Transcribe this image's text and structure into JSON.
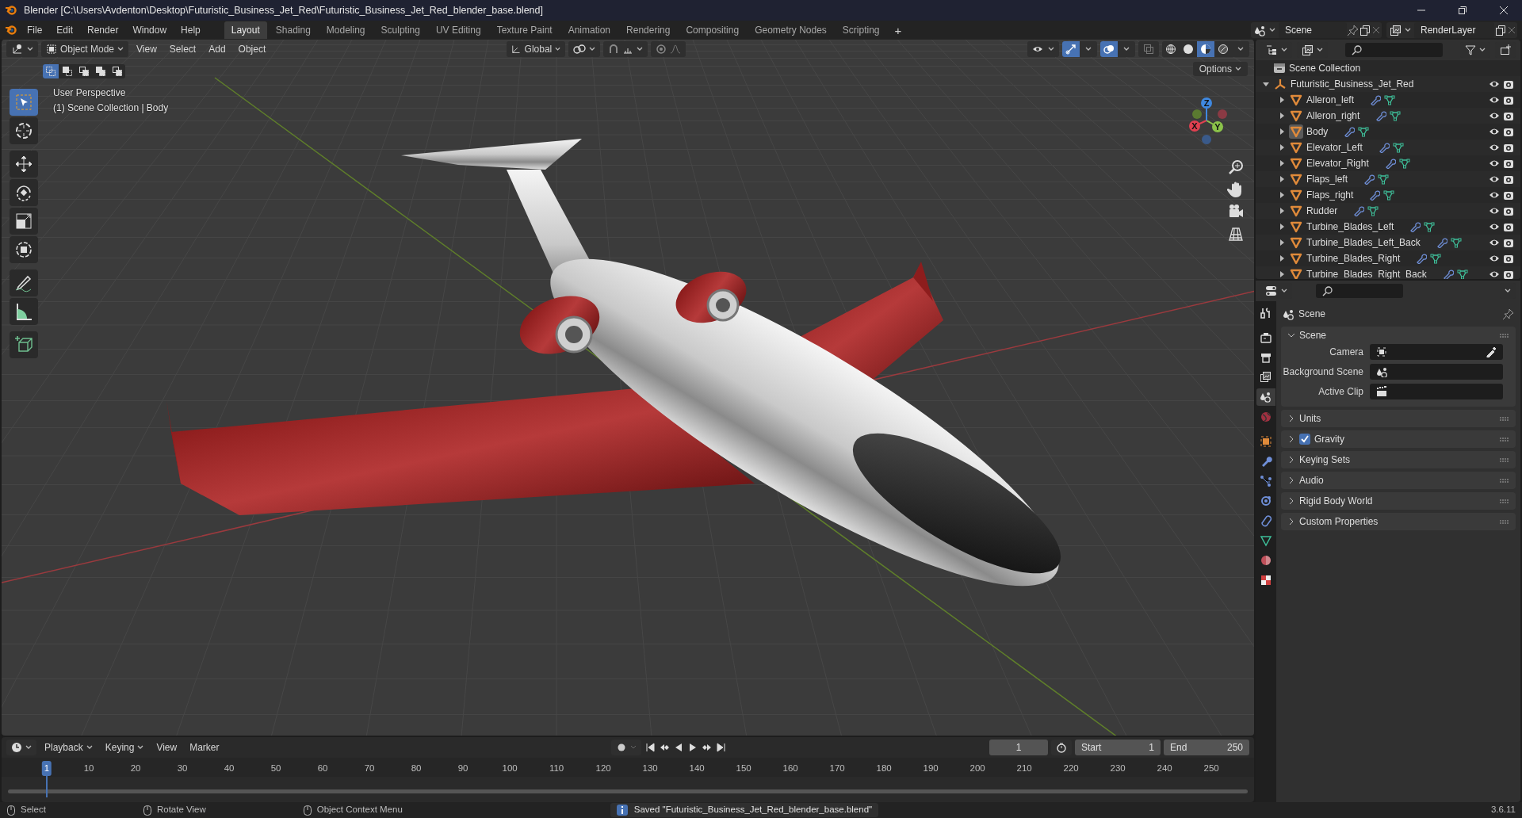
{
  "window": {
    "title": "Blender [C:\\Users\\Avdenton\\Desktop\\Futuristic_Business_Jet_Red\\Futuristic_Business_Jet_Red_blender_base.blend]"
  },
  "menu": [
    "File",
    "Edit",
    "Render",
    "Window",
    "Help"
  ],
  "workspaces": [
    {
      "label": "Layout",
      "selected": true
    },
    {
      "label": "Shading",
      "selected": false
    },
    {
      "label": "Modeling",
      "selected": false
    },
    {
      "label": "Sculpting",
      "selected": false
    },
    {
      "label": "UV Editing",
      "selected": false
    },
    {
      "label": "Texture Paint",
      "selected": false
    },
    {
      "label": "Animation",
      "selected": false
    },
    {
      "label": "Rendering",
      "selected": false
    },
    {
      "label": "Compositing",
      "selected": false
    },
    {
      "label": "Geometry Nodes",
      "selected": false
    },
    {
      "label": "Scripting",
      "selected": false
    }
  ],
  "add_workspace": "+",
  "scene": {
    "name": "Scene"
  },
  "view_layer": {
    "name": "RenderLayer"
  },
  "viewport": {
    "mode": "Object Mode",
    "menus": [
      "View",
      "Select",
      "Add",
      "Object"
    ],
    "orientation": "Global",
    "options": "Options",
    "info": [
      "User Perspective",
      "(1) Scene Collection | Body"
    ],
    "select_modes": [
      {
        "selected": true
      },
      {
        "selected": false
      },
      {
        "selected": false
      },
      {
        "selected": false
      },
      {
        "selected": false
      }
    ],
    "tools": [
      {
        "kind": "select",
        "selected": true
      },
      {
        "kind": "cursor",
        "selected": false
      },
      {
        "kind": "move",
        "selected": false
      },
      {
        "kind": "rotate",
        "selected": false
      },
      {
        "kind": "scale",
        "selected": false
      },
      {
        "kind": "transform",
        "selected": false
      },
      {
        "kind": "annotate",
        "selected": false
      },
      {
        "kind": "measure",
        "selected": false
      },
      {
        "kind": "add_cube",
        "selected": false
      }
    ],
    "shading": [
      {
        "kind": "wireframe",
        "selected": false
      },
      {
        "kind": "solid",
        "selected": false
      },
      {
        "kind": "material",
        "selected": true
      },
      {
        "kind": "rendered",
        "selected": false
      }
    ],
    "gizmo": {
      "x": "X",
      "y": "Y",
      "z": "Z"
    }
  },
  "outliner": {
    "root": "Scene Collection",
    "children": [
      {
        "name": "Futuristic_Business_Jet_Red",
        "kind": "collection",
        "expanded": true,
        "selected": false,
        "children": [
          {
            "name": "Alleron_left",
            "kind": "object",
            "expanded": false,
            "selected": false
          },
          {
            "name": "Alleron_right",
            "kind": "object",
            "expanded": false,
            "selected": false
          },
          {
            "name": "Body",
            "kind": "object",
            "expanded": false,
            "selected": true
          },
          {
            "name": "Elevator_Left",
            "kind": "object",
            "expanded": false,
            "selected": false
          },
          {
            "name": "Elevator_Right",
            "kind": "object",
            "expanded": false,
            "selected": false
          },
          {
            "name": "Flaps_left",
            "kind": "object",
            "expanded": false,
            "selected": false
          },
          {
            "name": "Flaps_right",
            "kind": "object",
            "expanded": false,
            "selected": false
          },
          {
            "name": "Rudder",
            "kind": "object",
            "expanded": false,
            "selected": false
          },
          {
            "name": "Turbine_Blades_Left",
            "kind": "object",
            "expanded": false,
            "selected": false
          },
          {
            "name": "Turbine_Blades_Left_Back",
            "kind": "object",
            "expanded": false,
            "selected": false
          },
          {
            "name": "Turbine_Blades_Right",
            "kind": "object",
            "expanded": false,
            "selected": false
          },
          {
            "name": "Turbine_Blades_Right_Back",
            "kind": "object",
            "expanded": false,
            "selected": false
          }
        ]
      }
    ]
  },
  "properties": {
    "tabs": [
      {
        "kind": "tool",
        "selected": false
      },
      {
        "kind": "render",
        "selected": false
      },
      {
        "kind": "output",
        "selected": false
      },
      {
        "kind": "view_layer",
        "selected": false
      },
      {
        "kind": "scene",
        "selected": true
      },
      {
        "kind": "world",
        "selected": false
      },
      {
        "kind": "object",
        "selected": false
      },
      {
        "kind": "modifiers",
        "selected": false
      },
      {
        "kind": "particles",
        "selected": false
      },
      {
        "kind": "physics",
        "selected": false
      },
      {
        "kind": "constraints",
        "selected": false
      },
      {
        "kind": "data",
        "selected": false
      },
      {
        "kind": "material",
        "selected": false
      },
      {
        "kind": "texture",
        "selected": false
      }
    ],
    "title": "Scene",
    "panels": [
      {
        "title": "Scene",
        "kind": "section",
        "expanded": true,
        "fields": [
          {
            "label": "Camera",
            "kind": "camera"
          },
          {
            "label": "Background Scene",
            "kind": "scene"
          },
          {
            "label": "Active Clip",
            "kind": "clip"
          }
        ]
      },
      {
        "title": "Units",
        "kind": "section",
        "expanded": false
      },
      {
        "title": "Gravity",
        "kind": "toggle",
        "expanded": false,
        "checked": true
      },
      {
        "title": "Keying Sets",
        "kind": "section",
        "expanded": false
      },
      {
        "title": "Audio",
        "kind": "section",
        "expanded": false
      },
      {
        "title": "Rigid Body World",
        "kind": "section",
        "expanded": false
      },
      {
        "title": "Custom Properties",
        "kind": "section",
        "expanded": false
      }
    ]
  },
  "timeline": {
    "menus": [
      "Playback",
      "Keying",
      "View",
      "Marker"
    ],
    "current_frame": "1",
    "start_label": "Start",
    "start": "1",
    "end_label": "End",
    "end": "250",
    "ticks": [
      {
        "label": "1",
        "selected": true
      },
      {
        "label": "10",
        "selected": false
      },
      {
        "label": "20",
        "selected": false
      },
      {
        "label": "30",
        "selected": false
      },
      {
        "label": "40",
        "selected": false
      },
      {
        "label": "50",
        "selected": false
      },
      {
        "label": "60",
        "selected": false
      },
      {
        "label": "70",
        "selected": false
      },
      {
        "label": "80",
        "selected": false
      },
      {
        "label": "90",
        "selected": false
      },
      {
        "label": "100",
        "selected": false
      },
      {
        "label": "110",
        "selected": false
      },
      {
        "label": "120",
        "selected": false
      },
      {
        "label": "130",
        "selected": false
      },
      {
        "label": "140",
        "selected": false
      },
      {
        "label": "150",
        "selected": false
      },
      {
        "label": "160",
        "selected": false
      },
      {
        "label": "170",
        "selected": false
      },
      {
        "label": "180",
        "selected": false
      },
      {
        "label": "190",
        "selected": false
      },
      {
        "label": "200",
        "selected": false
      },
      {
        "label": "210",
        "selected": false
      },
      {
        "label": "220",
        "selected": false
      },
      {
        "label": "230",
        "selected": false
      },
      {
        "label": "240",
        "selected": false
      },
      {
        "label": "250",
        "selected": false
      }
    ]
  },
  "status_bar": {
    "hints": [
      "Select",
      "Rotate View",
      "Object Context Menu"
    ],
    "message": "Saved \"Futuristic_Business_Jet_Red_blender_base.blend\"",
    "version": "3.6.11"
  }
}
